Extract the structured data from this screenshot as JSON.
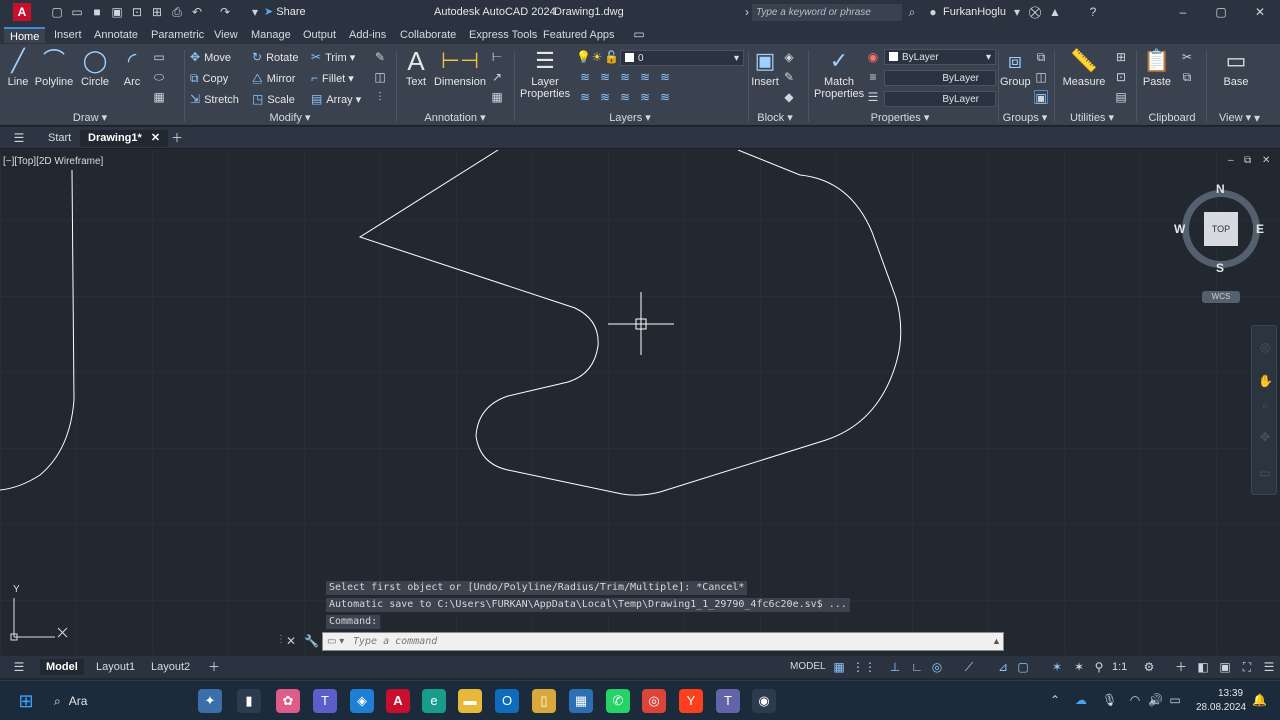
{
  "title_bar": {
    "app_title": "Autodesk AutoCAD 2024",
    "file_name": "Drawing1.dwg",
    "search_placeholder": "Type a keyword or phrase",
    "user_name": "FurkanHoglu",
    "share_label": "Share"
  },
  "ribbon_tabs": [
    "Home",
    "Insert",
    "Annotate",
    "Parametric",
    "View",
    "Manage",
    "Output",
    "Add-ins",
    "Collaborate",
    "Express Tools",
    "Featured Apps"
  ],
  "ribbon": {
    "draw": {
      "title": "Draw",
      "line": "Line",
      "polyline": "Polyline",
      "circle": "Circle",
      "arc": "Arc"
    },
    "modify": {
      "title": "Modify",
      "move": "Move",
      "rotate": "Rotate",
      "trim": "Trim",
      "copy": "Copy",
      "mirror": "Mirror",
      "fillet": "Fillet",
      "stretch": "Stretch",
      "scale": "Scale",
      "array": "Array"
    },
    "annotation": {
      "title": "Annotation",
      "text": "Text",
      "dimension": "Dimension"
    },
    "layers": {
      "title": "Layers",
      "layer_properties": "Layer\nProperties",
      "current_layer": "0"
    },
    "block": {
      "title": "Block",
      "insert": "Insert"
    },
    "properties": {
      "title": "Properties",
      "match": "Match\nProperties",
      "color": "ByLayer",
      "linetype": "ByLayer",
      "lineweight": "ByLayer"
    },
    "groups": {
      "title": "Groups",
      "group": "Group"
    },
    "utilities": {
      "title": "Utilities",
      "measure": "Measure"
    },
    "clipboard": {
      "title": "Clipboard",
      "paste": "Paste"
    },
    "view": {
      "title": "View",
      "base": "Base"
    }
  },
  "doc_tabs": {
    "start": "Start",
    "drawing": "Drawing1*"
  },
  "viewport": {
    "label": "[−][Top][2D Wireframe]",
    "viewcube": {
      "n": "N",
      "s": "S",
      "e": "E",
      "w": "W",
      "top": "TOP",
      "wcs": "WCS"
    },
    "ucs_y": "Y"
  },
  "command": {
    "history": [
      "Select first object or [Undo/Polyline/Radius/Trim/Multiple]: *Cancel*",
      "Automatic save to C:\\Users\\FURKAN\\AppData\\Local\\Temp\\Drawing1_1_29790_4fc6c20e.sv$ ...",
      "Command:"
    ],
    "placeholder": "Type a command"
  },
  "layout_tabs": [
    "Model",
    "Layout1",
    "Layout2"
  ],
  "status": {
    "model": "MODEL",
    "scale": "1:1"
  },
  "taskbar": {
    "search": "Ara",
    "time": "13:39",
    "date": "28.08.2024"
  },
  "colors": {
    "accent": "#3b8ddd",
    "canvas": "#212830",
    "ribbon": "#3a4250"
  }
}
